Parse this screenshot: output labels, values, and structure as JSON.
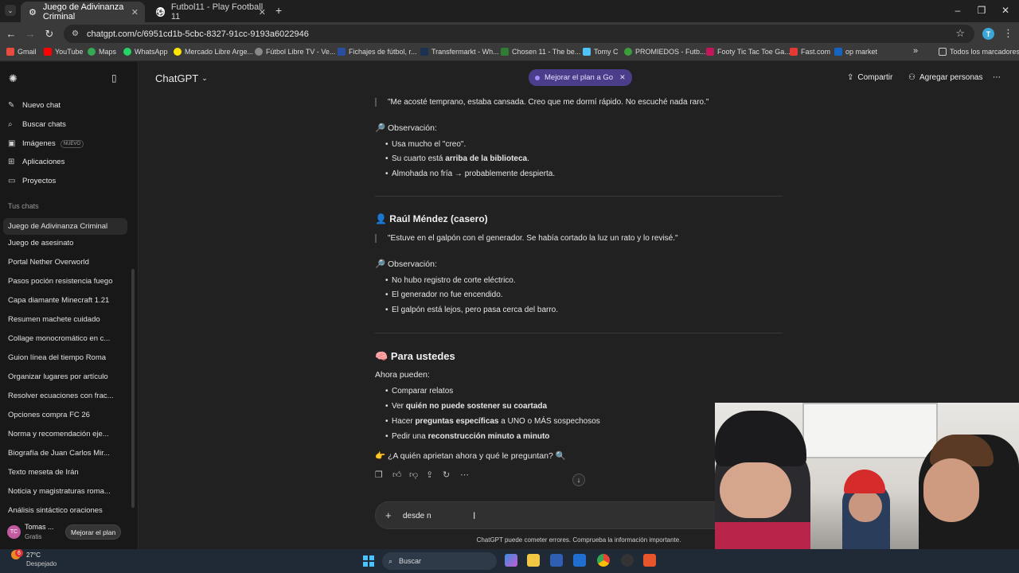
{
  "browser": {
    "tabs": [
      {
        "label": "Juego de Adivinanza Criminal",
        "active": true
      },
      {
        "label": "Futbol11 - Play Football 11",
        "active": false
      }
    ],
    "url": "chatgpt.com/c/6951cd1b-5cbc-8327-91cc-9193a6022946",
    "profile_initial": "T",
    "bookmarks": [
      "Gmail",
      "YouTube",
      "Maps",
      "WhatsApp",
      "Mercado Libre Arge...",
      "Fútbol Libre TV - Ve...",
      "Fichajes de fútbol, r...",
      "Transfermarkt - Wh...",
      "Chosen 11 - The be...",
      "Tomy C",
      "PROMIEDOS - Futb...",
      "Footy Tic Tac Toe Ga...",
      "Fast.com",
      "op market"
    ],
    "bookmarks_more": "»",
    "all_bookmarks": "Todos los marcadores"
  },
  "sidebar": {
    "nav": [
      {
        "label": "Nuevo chat",
        "icon": "edit-icon"
      },
      {
        "label": "Buscar chats",
        "icon": "search-icon"
      },
      {
        "label": "Imágenes",
        "icon": "image-icon",
        "badge": "NUEVO"
      },
      {
        "label": "Aplicaciones",
        "icon": "apps-icon"
      },
      {
        "label": "Proyectos",
        "icon": "folder-icon"
      }
    ],
    "section_title": "Tus chats",
    "chats": [
      "Juego de Adivinanza Criminal",
      "Juego de asesinato",
      "Portal Nether Overworld",
      "Pasos poción resistencia fuego",
      "Capa diamante Minecraft 1.21",
      "Resumen machete cuidado",
      "Collage monocromático en c...",
      "Guion línea del tiempo Roma",
      "Organizar lugares por artículo",
      "Resolver ecuaciones con frac...",
      "Opciones compra FC 26",
      "Norma y recomendación eje...",
      "Biografía de Juan Carlos Mir...",
      "Texto meseta de Irán",
      "Noticia y magistraturas roma...",
      "Análisis sintáctico oraciones"
    ],
    "user": {
      "initials": "TC",
      "name": "Tomas ...",
      "plan": "Gratis",
      "upgrade": "Mejorar el plan"
    }
  },
  "header": {
    "model": "ChatGPT",
    "promo": "Mejorar el plan a Go",
    "share": "Compartir",
    "add_people": "Agregar personas"
  },
  "conversation": {
    "quote1": "\"Me acosté temprano, estaba cansada. Creo que me dormí rápido. No escuché nada raro.\"",
    "obs_label": "Observación:",
    "obs1": [
      {
        "pre": "Usa mucho el \"creo\".",
        "bold": "",
        "post": ""
      },
      {
        "pre": "Su cuarto está ",
        "bold": "arriba de la biblioteca",
        "post": "."
      },
      {
        "pre": "Almohada no fría → probablemente despierta.",
        "bold": "",
        "post": ""
      }
    ],
    "person2": "Raúl Méndez (casero)",
    "quote2": "\"Estuve en el galpón con el generador. Se había cortado la luz un rato y lo revisé.\"",
    "obs2": [
      "No hubo registro de corte eléctrico.",
      "El generador no fue encendido.",
      "El galpón está lejos, pero pasa cerca del barro."
    ],
    "section": "Para ustedes",
    "intro": "Ahora pueden:",
    "tasks": [
      {
        "pre": "Comparar relatos",
        "bold": "",
        "post": ""
      },
      {
        "pre": "Ver ",
        "bold": "quién no puede sostener su coartada",
        "post": ""
      },
      {
        "pre": "Hacer ",
        "bold": "preguntas específicas",
        "post": " a UNO o MÁS sospechosos"
      },
      {
        "pre": "Pedir una ",
        "bold": "reconstrucción minuto a minuto",
        "post": ""
      }
    ],
    "closing": "¿A quién aprietan ahora y qué le preguntan?"
  },
  "composer": {
    "value": "desde  n"
  },
  "disclaimer": "ChatGPT puede cometer errores. Comprueba la información importante.",
  "taskbar": {
    "badge": "6",
    "temp": "27°C",
    "weather": "Despejado",
    "search": "Buscar"
  },
  "colors": {
    "promo_bg": "#4b3d8a",
    "bg": "#212121",
    "sidebar_bg": "#181818"
  }
}
